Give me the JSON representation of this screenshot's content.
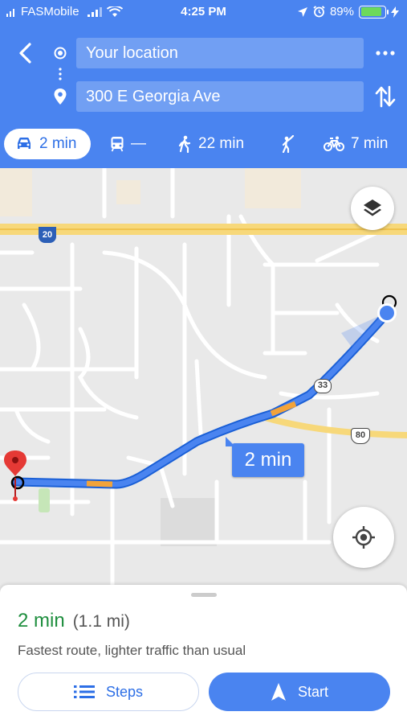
{
  "status_bar": {
    "carrier": "FASMobile",
    "time": "4:25 PM",
    "battery": "89%",
    "battery_level": 0.89,
    "icons": [
      "signal-icon",
      "wifi-icon",
      "location-arrow-icon",
      "alarm-icon",
      "battery-icon",
      "charging-icon"
    ]
  },
  "directions": {
    "origin": "Your location",
    "destination": "300 E Georgia Ave",
    "modes": [
      {
        "icon": "car-icon",
        "label": "2 min",
        "selected": true
      },
      {
        "icon": "transit-icon",
        "label": "—"
      },
      {
        "icon": "walk-icon",
        "label": "22 min"
      },
      {
        "icon": "ride-hail-icon",
        "label": ""
      },
      {
        "icon": "bike-icon",
        "label": "7 min"
      }
    ]
  },
  "map": {
    "route_time_bubble": "2 min",
    "shields": [
      "20",
      "33",
      "80"
    ],
    "colors": {
      "route": "#4a84f0",
      "traffic": "#f2a33a",
      "highway": "#f7d87a",
      "pin": "#e53935"
    }
  },
  "sheet": {
    "eta": "2 min",
    "distance": "(1.1 mi)",
    "summary": "Fastest route, lighter traffic than usual",
    "steps_label": "Steps",
    "start_label": "Start"
  }
}
